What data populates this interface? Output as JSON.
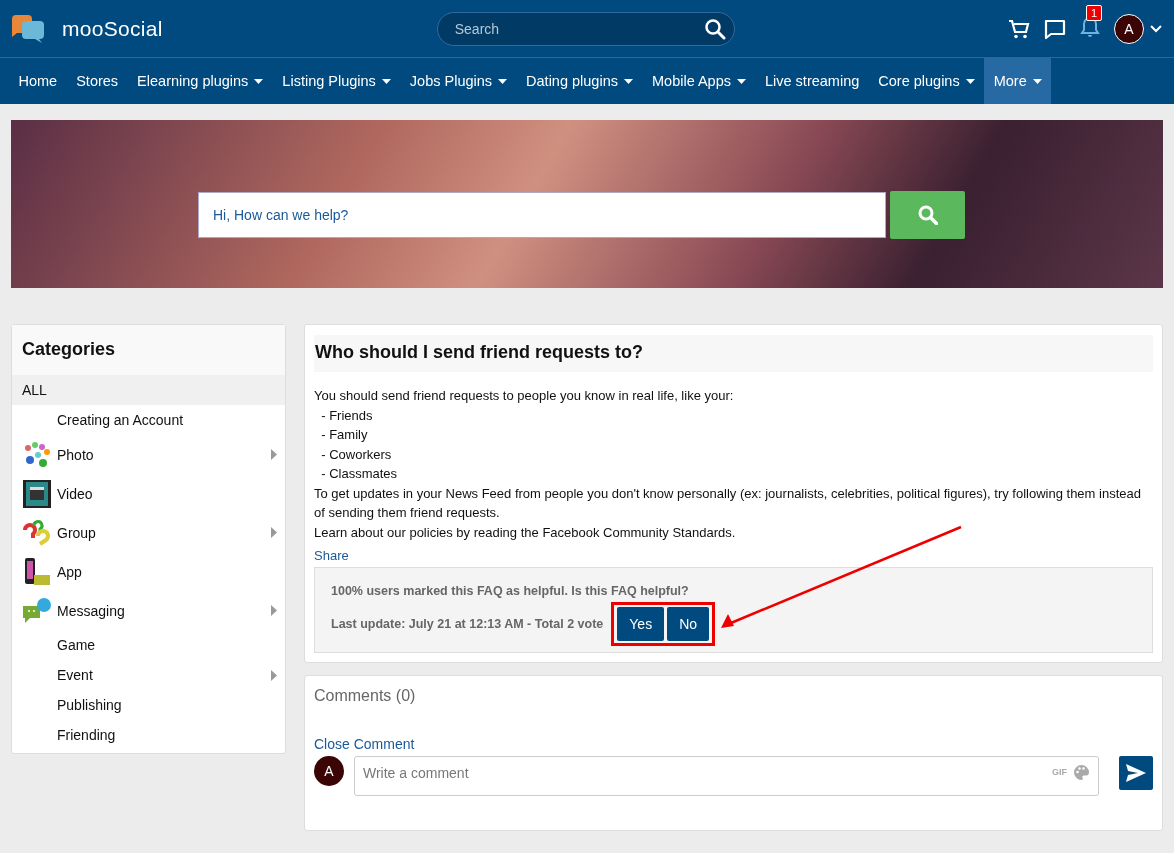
{
  "header": {
    "logo": "mooSocial",
    "search": {
      "placeholder": "Search"
    },
    "notification_count": "1",
    "avatar_letter": "A"
  },
  "nav": [
    {
      "label": "Home",
      "dropdown": false,
      "selected": false
    },
    {
      "label": "Stores",
      "dropdown": false,
      "selected": false
    },
    {
      "label": "Elearning plugins",
      "dropdown": true,
      "selected": false
    },
    {
      "label": "Listing Plugins",
      "dropdown": true,
      "selected": false
    },
    {
      "label": "Jobs Plugins",
      "dropdown": true,
      "selected": false
    },
    {
      "label": "Dating plugins",
      "dropdown": true,
      "selected": false
    },
    {
      "label": "Mobile Apps",
      "dropdown": true,
      "selected": false
    },
    {
      "label": "Live streaming",
      "dropdown": false,
      "selected": false
    },
    {
      "label": "Core plugins",
      "dropdown": true,
      "selected": false
    },
    {
      "label": "More",
      "dropdown": true,
      "selected": true
    }
  ],
  "banner": {
    "search": {
      "placeholder": "Hi, How can we help?"
    }
  },
  "categories": {
    "title": "Categories",
    "items": [
      {
        "label": "ALL",
        "selected": true,
        "thumbnail": false,
        "submenu": false
      },
      {
        "label": "Creating an Account",
        "selected": false,
        "thumbnail": false,
        "submenu": false
      },
      {
        "label": "Photo",
        "selected": false,
        "thumbnail": true,
        "submenu": true
      },
      {
        "label": "Video",
        "selected": false,
        "thumbnail": true,
        "submenu": false
      },
      {
        "label": "Group",
        "selected": false,
        "thumbnail": true,
        "submenu": true
      },
      {
        "label": "App",
        "selected": false,
        "thumbnail": true,
        "submenu": false
      },
      {
        "label": "Messaging",
        "selected": false,
        "thumbnail": true,
        "submenu": true
      },
      {
        "label": "Game",
        "selected": false,
        "thumbnail": false,
        "submenu": false
      },
      {
        "label": "Event",
        "selected": false,
        "thumbnail": false,
        "submenu": true
      },
      {
        "label": "Publishing",
        "selected": false,
        "thumbnail": false,
        "submenu": false
      },
      {
        "label": "Friending",
        "selected": false,
        "thumbnail": false,
        "submenu": false
      }
    ]
  },
  "faq": {
    "title": "Who should I send friend requests to?",
    "body_lines": [
      "You should send friend requests to people you know in real life, like your:",
      "  - Friends",
      "  - Family",
      "  - Coworkers",
      "  - Classmates",
      "To get updates in your News Feed from people you don't know personally (ex: journalists, celebrities, political figures), try following them instead of sending them friend requests.",
      "Learn about our policies by reading the Facebook Community Standards."
    ],
    "share": "Share",
    "helpful_text": "100% users marked this FAQ as helpful. Is this FAQ helpful?",
    "last_update": "Last update: July 21 at 12:13 AM - Total 2 vote",
    "buttons": [
      "Yes",
      "No"
    ]
  },
  "comments": {
    "title": "Comments (0)",
    "close_link": "Close Comment",
    "avatar_letter": "A",
    "placeholder": "Write a comment",
    "gif": "GIF"
  }
}
